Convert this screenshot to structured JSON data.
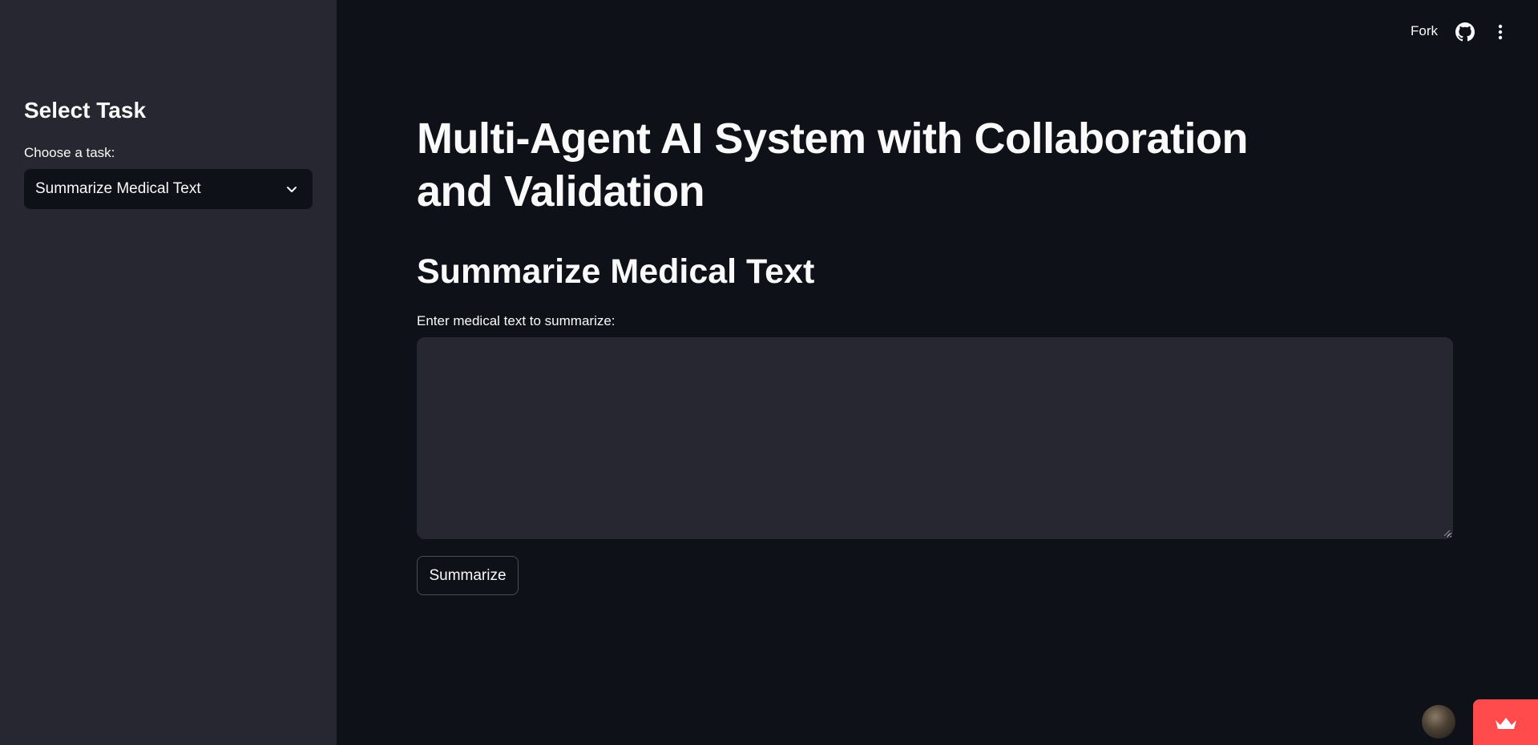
{
  "sidebar": {
    "title": "Select Task",
    "select_label": "Choose a task:",
    "selected_task": "Summarize Medical Text"
  },
  "toolbar": {
    "fork_label": "Fork",
    "github_icon": "github-icon",
    "menu_icon": "kebab-menu-icon"
  },
  "main": {
    "title": "Multi-Agent AI System with Collaboration and Validation",
    "section_title": "Summarize Medical Text",
    "textarea_label": "Enter medical text to summarize:",
    "textarea_value": "",
    "button_label": "Summarize"
  },
  "colors": {
    "background": "#0e1117",
    "sidebar": "#262730",
    "text": "#fafafa",
    "accent": "#ff4b4b"
  }
}
